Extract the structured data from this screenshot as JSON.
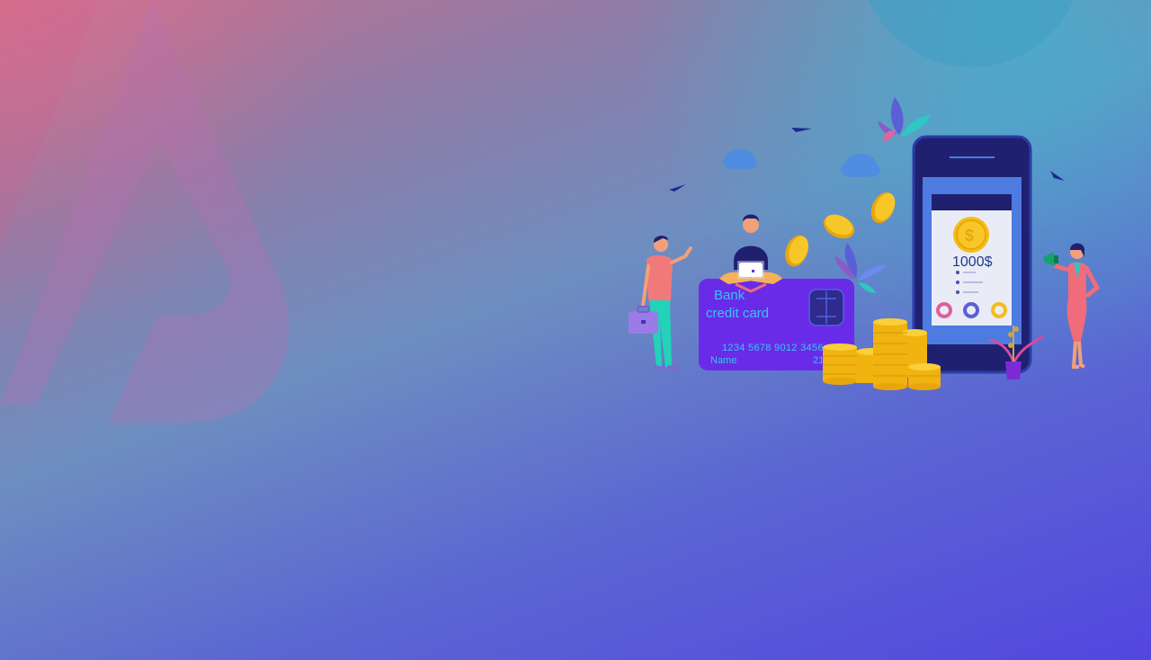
{
  "hero": {
    "card": {
      "bank_label": "Bank",
      "type_label": "credit card",
      "number": "1234  5678  9012  3456",
      "name_label": "Name",
      "expiry_partial": "21"
    },
    "phone": {
      "amount": "1000$",
      "coin_symbol": "$"
    },
    "icons": [
      "logo-mark-icon",
      "coin-icon",
      "cloud-icon",
      "leaf-icon",
      "paper-plane-icon",
      "megaphone-icon",
      "briefcase-icon",
      "laptop-icon"
    ]
  },
  "colors": {
    "card": "#6a2be8",
    "card_text": "#35c6f2",
    "phone_frame": "#1f2170",
    "phone_screen": "#4d7be0",
    "coin": "#f5bd16",
    "woman_dress": "#f06c7a",
    "man_shirt": "#f07a7a",
    "man_pants": "#22d3b8"
  }
}
